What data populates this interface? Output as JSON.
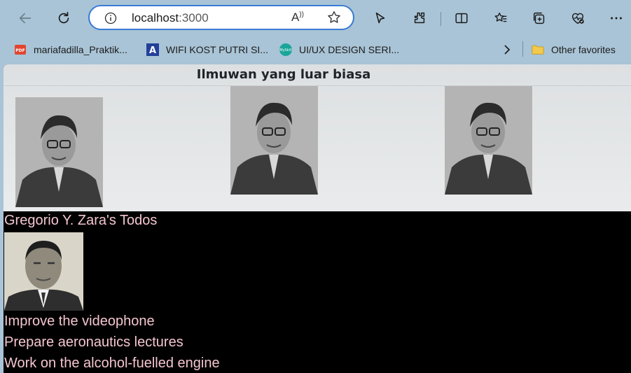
{
  "browser": {
    "url_host": "localhost",
    "url_port": ":3000",
    "read_aloud_glyph": "A͡",
    "icons": [
      "back-icon",
      "refresh-icon",
      "info-icon",
      "read-aloud-icon",
      "favorite-star-icon",
      "cursor-icon",
      "extensions-icon",
      "split-screen-icon",
      "favorites-icon",
      "collections-icon",
      "browser-essentials-icon",
      "more-icon"
    ]
  },
  "bookmarks": {
    "items": [
      {
        "label": "mariafadilla_Praktik...",
        "icon": "pdf-icon"
      },
      {
        "label": "WIFI KOST PUTRI SI...",
        "icon": "a-letter-icon"
      },
      {
        "label": "UI/UX DESIGN SERI...",
        "icon": "mysk-icon"
      }
    ],
    "other_favorites": "Other favorites"
  },
  "page": {
    "header_title": "Ilmuwan yang luar biasa",
    "todo_title": "Gregorio Y. Zara's Todos",
    "todos": [
      "Improve the videophone",
      "Prepare aeronautics lectures",
      "Work on the alcohol-fuelled engine"
    ]
  },
  "colors": {
    "chrome_bg": "#a9c4d6",
    "address_border": "#3a7bd5",
    "header_card_bg": "#e3e5e7",
    "page_bg": "#000000",
    "todo_text": "#f5c6cf"
  }
}
